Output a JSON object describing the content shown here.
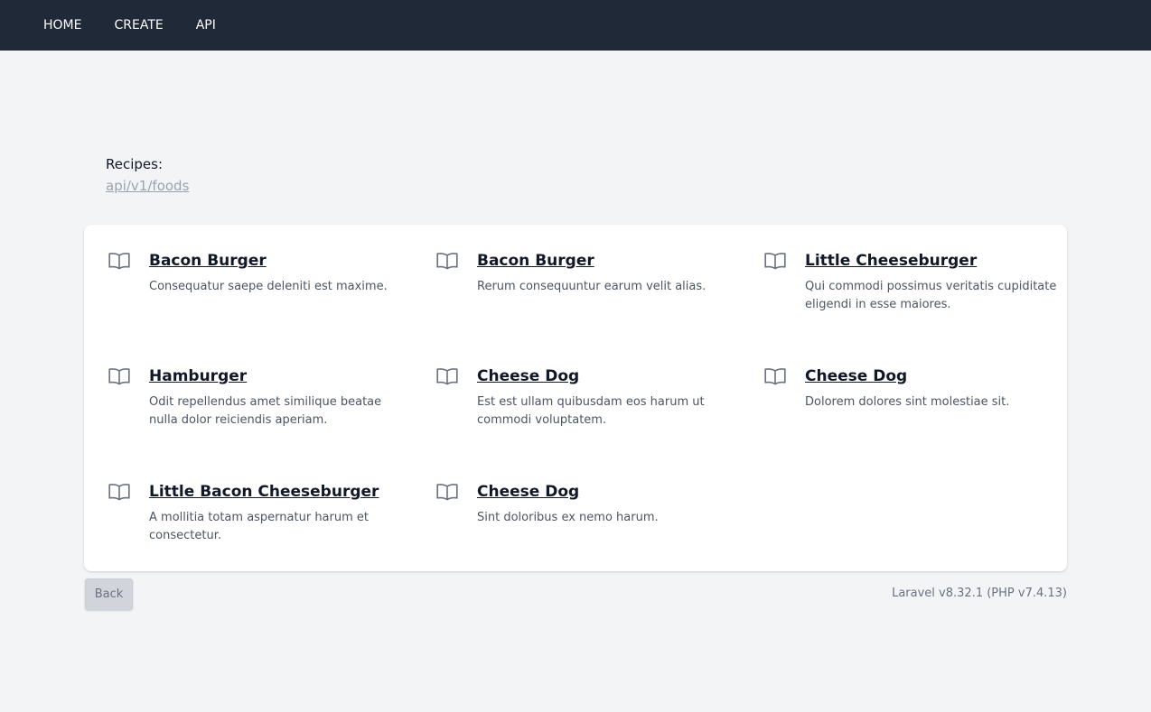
{
  "nav": {
    "items": [
      {
        "label": "HOME"
      },
      {
        "label": "CREATE"
      },
      {
        "label": "API"
      }
    ]
  },
  "header": {
    "label": "Recipes:",
    "link": "api/v1/foods"
  },
  "recipes": [
    {
      "title": "Bacon Burger",
      "description": "Consequatur saepe deleniti est maxime.",
      "icon": "book-open-icon"
    },
    {
      "title": "Bacon Burger",
      "description": "Rerum consequuntur earum velit alias.",
      "icon": "book-open-icon"
    },
    {
      "title": "Little Cheeseburger",
      "description": "Qui commodi possimus veritatis cupiditate eligendi in esse maiores.",
      "icon": "book-open-icon"
    },
    {
      "title": "Hamburger",
      "description": "Odit repellendus amet similique beatae nulla dolor reiciendis aperiam.",
      "icon": "book-open-icon"
    },
    {
      "title": "Cheese Dog",
      "description": "Est est ullam quibusdam eos harum ut commodi voluptatem.",
      "icon": "book-open-icon"
    },
    {
      "title": "Cheese Dog",
      "description": "Dolorem dolores sint molestiae sit.",
      "icon": "book-open-icon"
    },
    {
      "title": "Little Bacon Cheeseburger",
      "description": "A mollitia totam aspernatur harum et consectetur.",
      "icon": "book-open-icon"
    },
    {
      "title": "Cheese Dog",
      "description": "Sint doloribus ex nemo harum.",
      "icon": "book-open-icon"
    }
  ],
  "footer": {
    "back_label": "Back",
    "version": "Laravel v8.32.1 (PHP v7.4.13)"
  },
  "colors": {
    "nav_bg": "#1f2937",
    "page_bg": "#f3f4f6",
    "icon": "#6b7280"
  }
}
